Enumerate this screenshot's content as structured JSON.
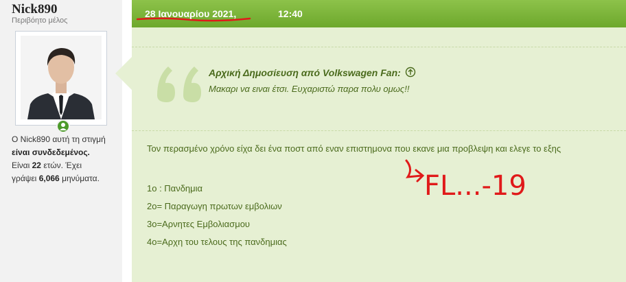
{
  "user": {
    "name": "Nick890",
    "title": "Περιβόητο μέλος",
    "status_line1_a": "Ο Nick890 αυτή τη στιγμή",
    "status_line1_b": "είναι συνδεδεμένος.",
    "age_prefix": "Είναι",
    "age_value": "22",
    "age_suffix": "ετών. Έχει",
    "posts_prefix": "γράψει",
    "posts_value": "6,066",
    "posts_suffix": "μηνύματα."
  },
  "post": {
    "date": "28 Ιανουαρίου 2021,",
    "time": "12:40",
    "quote_header": "Αρχική Δημοσίευση από Volkswagen Fan:",
    "quote_text": "Μακαρι να ειναι έτσι. Ευχαριστώ παρα πολυ ομως!!",
    "body": "Τον περασμένο χρόνο είχα δει ένα ποστ από εναν επιστημονα που εκανε μια προβλεψη και ελεγε το εξης",
    "list": [
      "1ο : Πανδημια",
      "2ο= Παραγωγη πρωτων εμβολιων",
      "3ο=Αρνητες Εμβολιασμου",
      "4ο=Αρχη του τελους της πανδημιας"
    ],
    "annotation": "FL...-19"
  },
  "colors": {
    "header_green": "#7cb83c",
    "post_bg": "#e6f0d3",
    "text_green": "#4a6a1c",
    "annotation_red": "#e01a1a",
    "online_green": "#4c9a2a"
  },
  "icons": [
    "online-status-icon",
    "quote-mark-icon",
    "view-original-post-icon"
  ]
}
